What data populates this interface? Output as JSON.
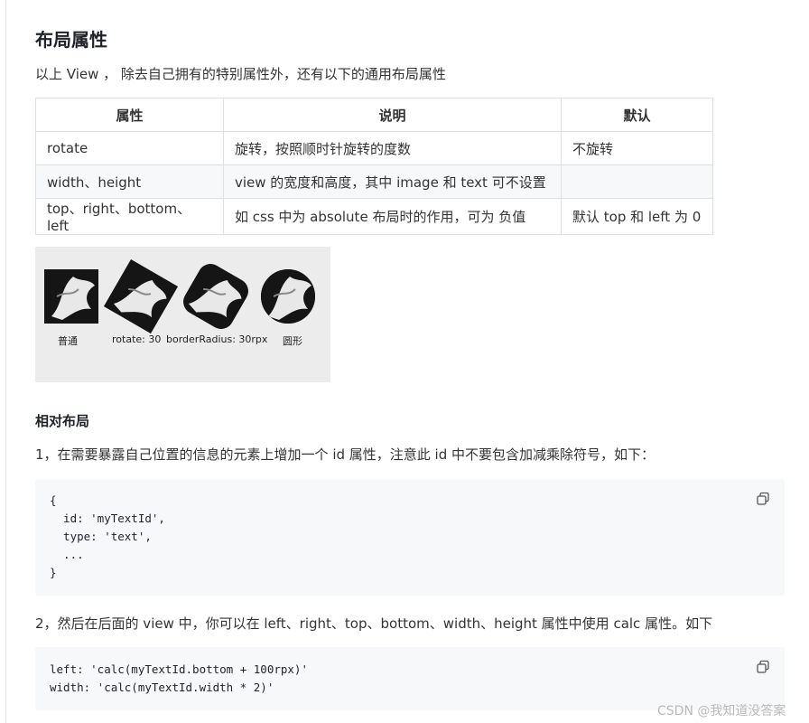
{
  "section": {
    "title": "布局属性",
    "intro": "以上 View ， 除去自己拥有的特别属性外，还有以下的通用布局属性"
  },
  "table": {
    "headers": [
      "属性",
      "说明",
      "默认"
    ],
    "rows": [
      [
        "rotate",
        "旋转，按照顺时针旋转的度数",
        "不旋转"
      ],
      [
        "width、height",
        "view 的宽度和高度，其中 image 和 text 可不设置",
        ""
      ],
      [
        "top、right、bottom、left",
        "如 css 中为 absolute 布局时的作用，可为 负值",
        "默认 top 和 left 为 0"
      ]
    ]
  },
  "demo": {
    "captions": [
      "普通",
      "rotate: 30",
      "borderRadius: 30rpx",
      "圆形"
    ]
  },
  "relative": {
    "title": "相对布局",
    "step1": "1，在需要暴露自己位置的信息的元素上增加一个 id 属性，注意此 id 中不要包含加减乘除符号，如下：",
    "code1": [
      "{",
      "  id: 'myTextId',",
      "  type: 'text',",
      "  ...",
      "}"
    ],
    "step2": "2，然后在后面的 view 中，你可以在 left、right、top、bottom、width、height 属性中使用 calc 属性。如下",
    "code2": [
      "left: 'calc(myTextId.bottom + 100rpx)'",
      "width: 'calc(myTextId.width * 2)'"
    ]
  },
  "icons": {
    "copy": "copy-icon"
  },
  "watermark": "CSDN @我知道没答案"
}
